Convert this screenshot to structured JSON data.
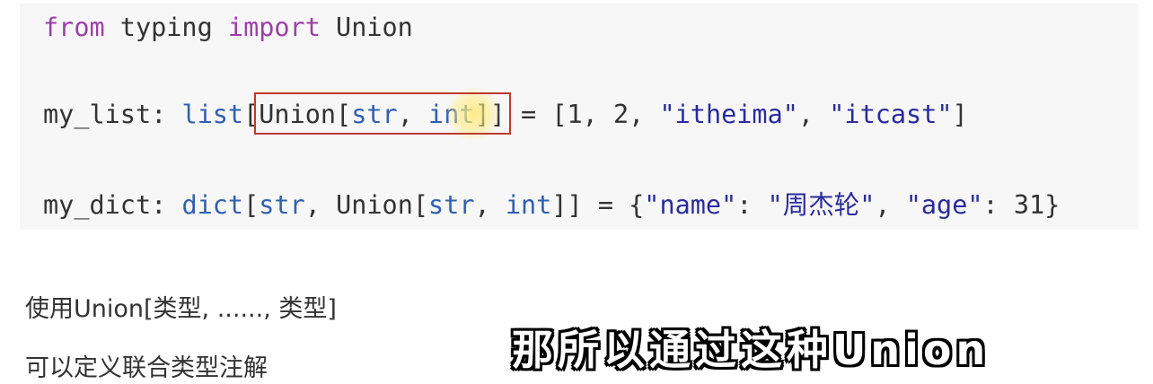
{
  "code": {
    "line1": {
      "kw_from": "from",
      "module": " typing ",
      "kw_import": "import",
      "name": " Union"
    },
    "line2": {
      "var": "my_list",
      "colon": ": ",
      "type_list": "list",
      "open": "[",
      "union": "Union",
      "open2": "[",
      "type_str": "str",
      "comma": ", ",
      "type_int": "int",
      "close": "]]",
      "assign": " = [",
      "n1": "1",
      "sep1": ", ",
      "n2": "2",
      "sep2": ", ",
      "s1": "\"itheima\"",
      "sep3": ", ",
      "s2": "\"itcast\"",
      "end": "]"
    },
    "line3": {
      "var": "my_dict",
      "colon": ": ",
      "type_dict": "dict",
      "open": "[",
      "type_str": "str",
      "comma": ", ",
      "union": "Union",
      "open2": "[",
      "type_str2": "str",
      "comma2": ", ",
      "type_int": "int",
      "close": "]]",
      "assign": " = {",
      "k1": "\"name\"",
      "c1": ": ",
      "v1": "\"周杰轮\"",
      "sep1": ", ",
      "k2": "\"age\"",
      "c2": ": ",
      "v2": "31",
      "end": "}"
    }
  },
  "notes": {
    "line1": "使用Union[类型, ......, 类型]",
    "line2": "可以定义联合类型注解"
  },
  "subtitle": "那所以通过这种Union",
  "colors": {
    "keyword": "#9c3fa8",
    "type": "#3060b0",
    "string": "#2b2b9e",
    "highlight_border": "#c0392b"
  }
}
